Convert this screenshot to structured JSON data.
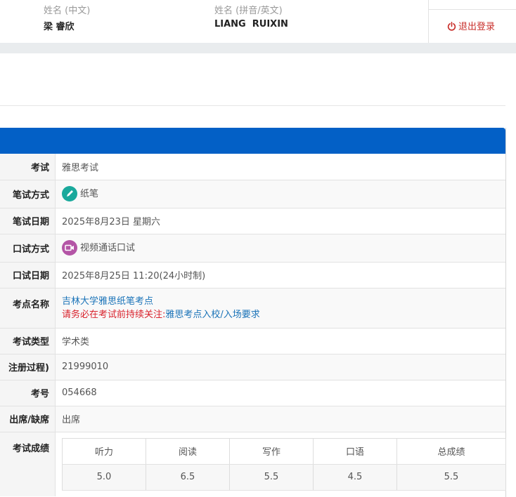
{
  "header": {
    "cn_name_label": "姓名 (中文)",
    "cn_name_value": "梁 睿欣",
    "en_name_label": "姓名 (拼音/英文)",
    "en_name_value": "LIANG  RUIXIN",
    "logout_label": "退出登录"
  },
  "colors": {
    "panel_header": "#0360c6",
    "written_icon": "#1aa99c",
    "speaking_icon": "#b455a6",
    "link": "#1a73b8",
    "warning": "#d9232d"
  },
  "rows": {
    "exam": {
      "label": "考试",
      "value": "雅思考试"
    },
    "written_mode": {
      "label": "笔试方式",
      "value": "纸笔",
      "icon": "pencil-icon"
    },
    "written_date": {
      "label": "笔试日期",
      "value": "2025年8月23日 星期六"
    },
    "speaking_mode": {
      "label": "口试方式",
      "value": "视频通话口试",
      "icon": "video-camera-icon"
    },
    "speaking_date": {
      "label": "口试日期",
      "value": "2025年8月25日 11:20(24小时制)"
    },
    "venue": {
      "label": "考点名称",
      "value": "吉林大学雅思纸笔考点",
      "notice_prefix": "请务必在考试前持续关注:",
      "notice_link": "雅思考点入校/入场要求"
    },
    "exam_type": {
      "label": "考试类型",
      "value": "学术类"
    },
    "registration": {
      "label": "注册过程)",
      "value": "21999010"
    },
    "candidate_no": {
      "label": "考号",
      "value": "054668"
    },
    "attendance": {
      "label": "出席/缺席",
      "value": "出席"
    },
    "scores": {
      "label": "考试成绩",
      "headers": [
        "听力",
        "阅读",
        "写作",
        "口语",
        "总成绩"
      ],
      "values": [
        "5.0",
        "6.5",
        "5.5",
        "4.5",
        "5.5"
      ]
    }
  }
}
